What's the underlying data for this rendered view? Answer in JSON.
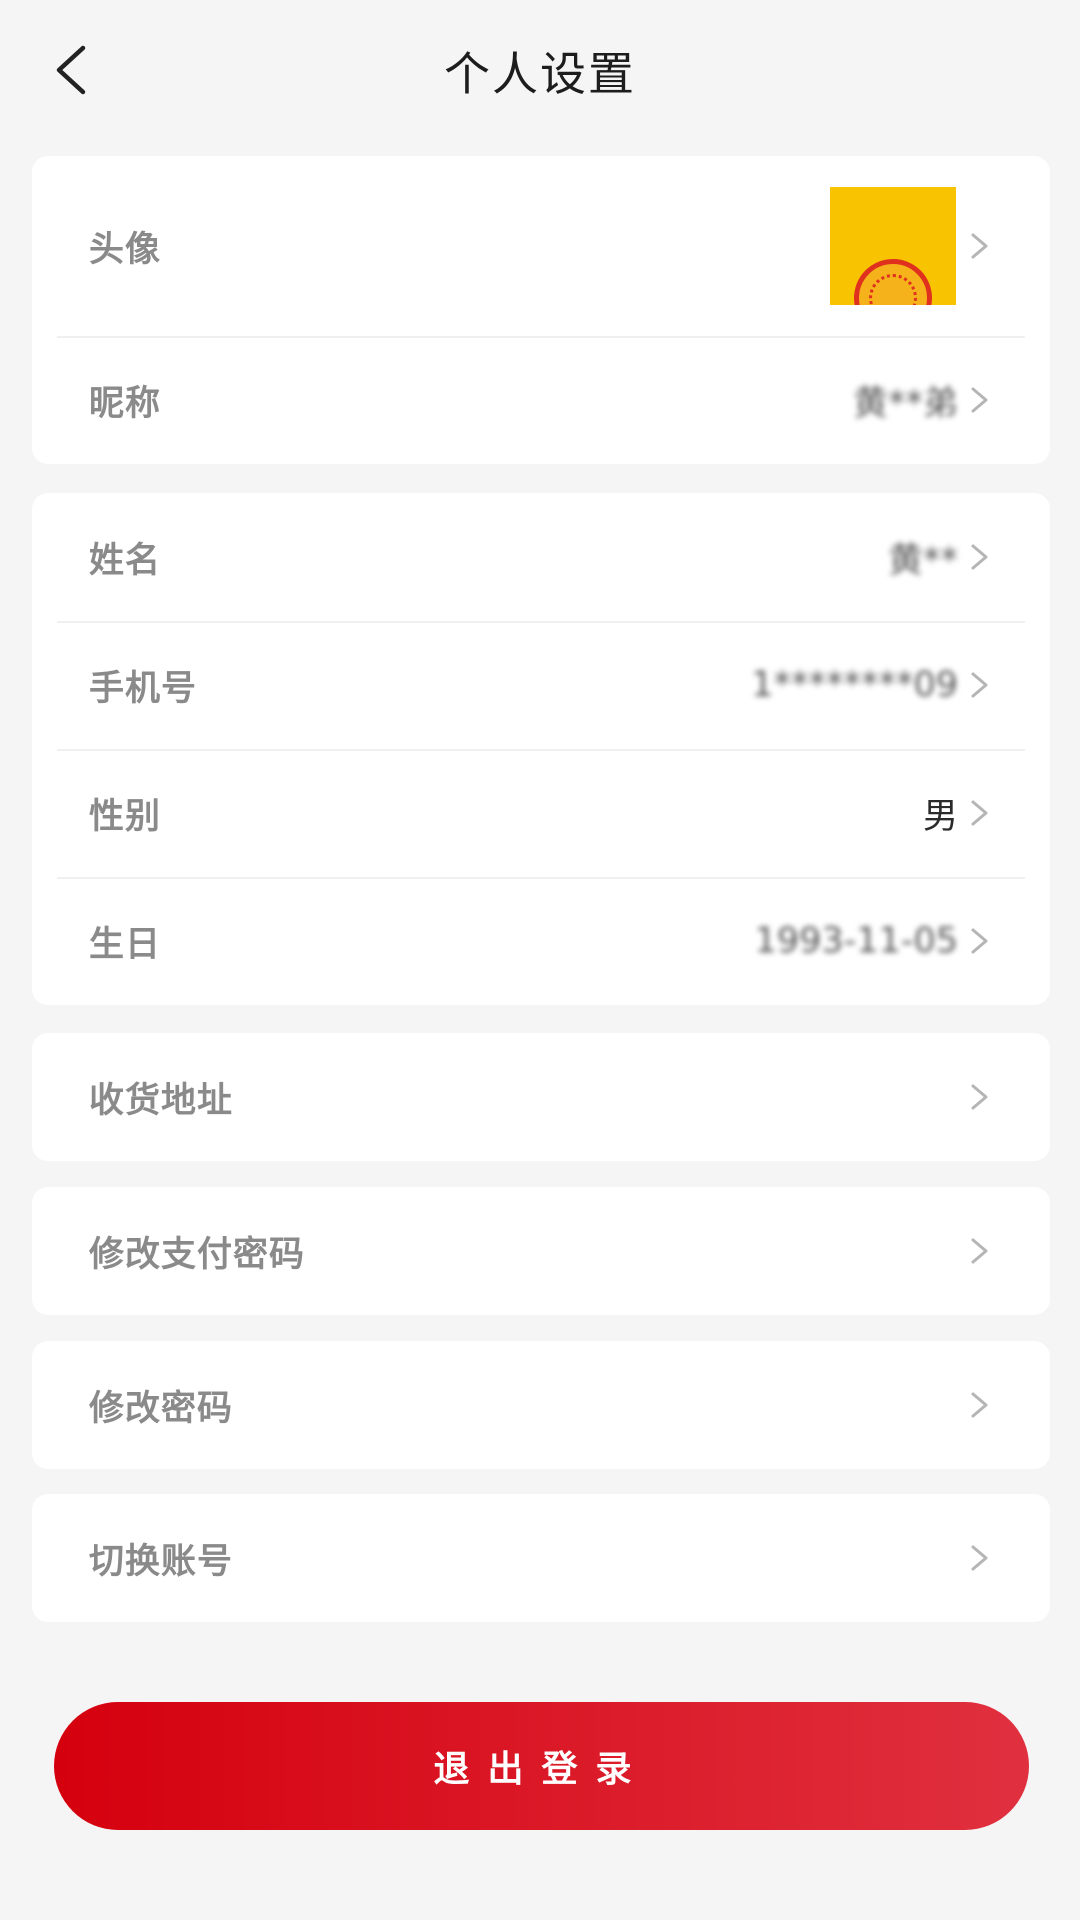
{
  "header": {
    "title": "个人设置",
    "back_icon": "chevron-left-icon"
  },
  "profile": {
    "avatar_label": "头像",
    "nickname_label": "昵称",
    "nickname_value": "黄**弟"
  },
  "info": {
    "name_label": "姓名",
    "name_value": "黄**",
    "phone_label": "手机号",
    "phone_value": "1********09",
    "gender_label": "性别",
    "gender_value": "男",
    "birthday_label": "生日",
    "birthday_value": "1993-11-05"
  },
  "menu": {
    "address_label": "收货地址",
    "pay_password_label": "修改支付密码",
    "password_label": "修改密码",
    "switch_account_label": "切换账号"
  },
  "logout_label": "退出登录",
  "colors": {
    "accent": "#d5000e",
    "background": "#f5f5f6"
  }
}
